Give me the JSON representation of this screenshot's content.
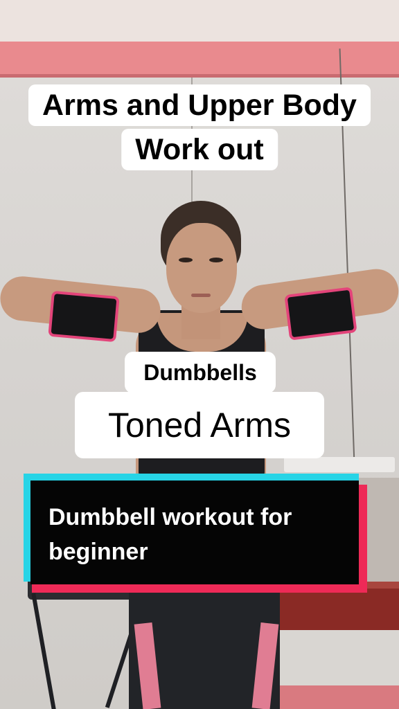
{
  "overlay": {
    "title_line1": "Arms and Upper Body",
    "title_line2": "Work out",
    "label_small": "Dumbbells",
    "label_large": "Toned Arms",
    "sticker_text": "Dumbbell workout for\nbeginner"
  },
  "colors": {
    "caption_bg": "#ffffff",
    "caption_text": "#000000",
    "sticker_bg": "#050505",
    "sticker_text": "#ffffff",
    "sticker_cyan": "#27d4e6",
    "sticker_red": "#ee2a57",
    "armband_trim": "#e3447a",
    "wall_band": "#e98a8e"
  }
}
